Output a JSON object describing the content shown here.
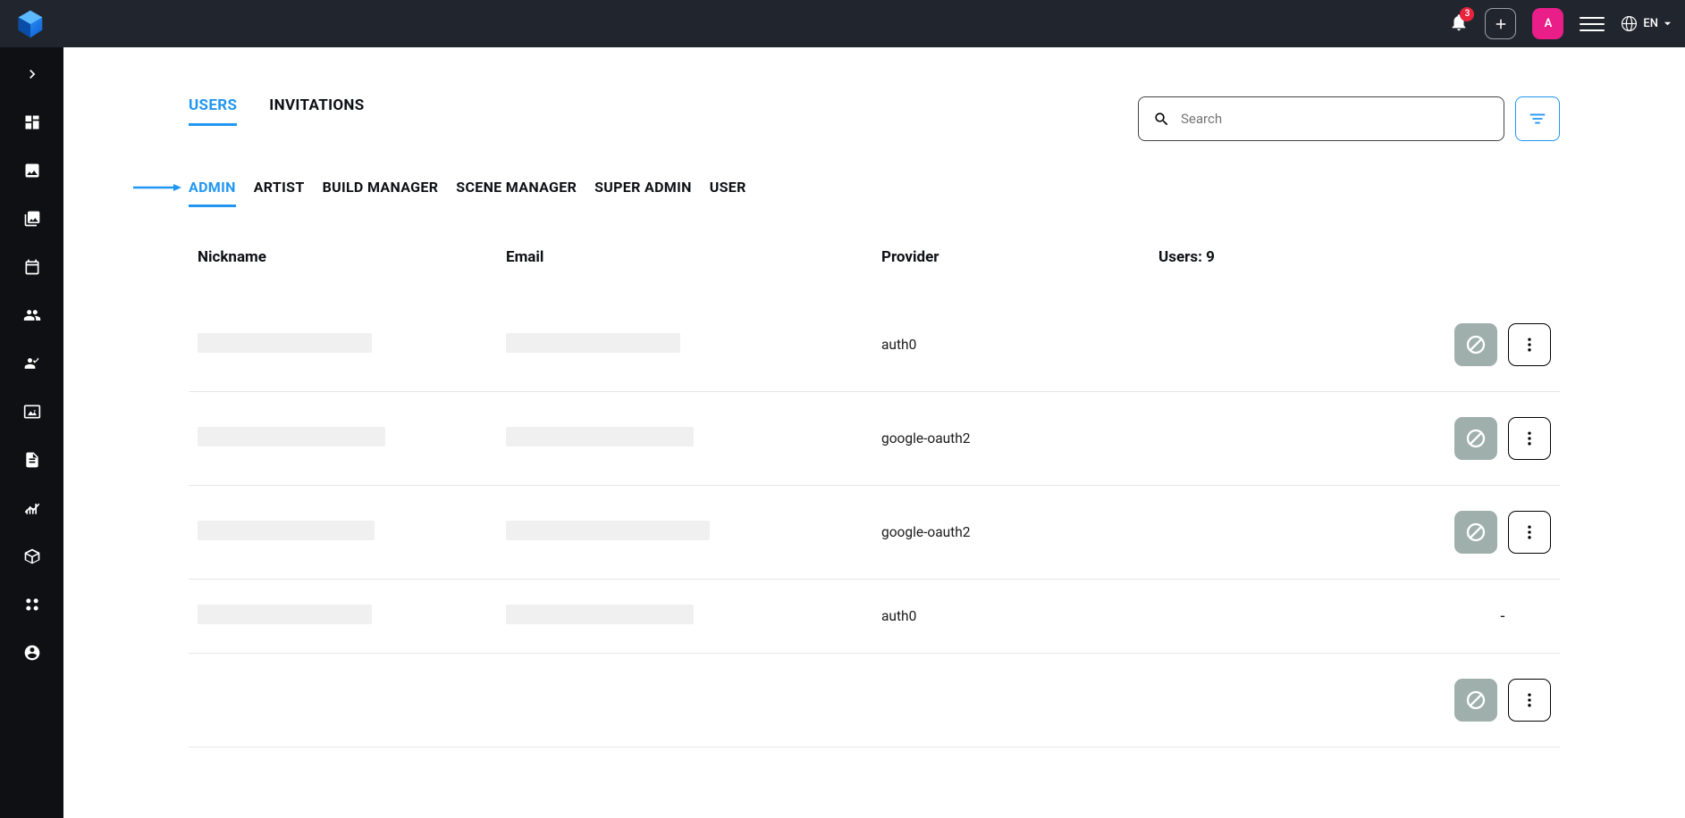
{
  "header": {
    "notification_count": "3",
    "avatar_letter": "A",
    "language_label": "EN"
  },
  "tabs": {
    "users": "USERS",
    "invitations": "INVITATIONS"
  },
  "search": {
    "placeholder": "Search"
  },
  "role_tabs": {
    "admin": "ADMIN",
    "artist": "ARTIST",
    "build_manager": "BUILD MANAGER",
    "scene_manager": "SCENE MANAGER",
    "super_admin": "SUPER ADMIN",
    "user": "USER"
  },
  "table": {
    "headers": {
      "nickname": "Nickname",
      "email": "Email",
      "provider": "Provider",
      "count_label": "Users: 9"
    },
    "rows": [
      {
        "nickname": "",
        "email": "",
        "provider": "auth0",
        "actions": "buttons",
        "nick_w": 195,
        "email_w": 195
      },
      {
        "nickname": "",
        "email": "",
        "provider": "google-oauth2",
        "actions": "buttons",
        "nick_w": 210,
        "email_w": 210
      },
      {
        "nickname": "",
        "email": "",
        "provider": "google-oauth2",
        "actions": "buttons",
        "nick_w": 198,
        "email_w": 228
      },
      {
        "nickname": "",
        "email": "",
        "provider": "auth0",
        "actions": "dash",
        "nick_w": 195,
        "email_w": 210
      },
      {
        "nickname": "",
        "email": "",
        "provider": "",
        "actions": "buttons",
        "nick_w": 0,
        "email_w": 0
      }
    ],
    "dash_label": "-"
  },
  "colors": {
    "accent": "#2196f3",
    "pink": "#e91e89",
    "badge": "#e8233b"
  }
}
